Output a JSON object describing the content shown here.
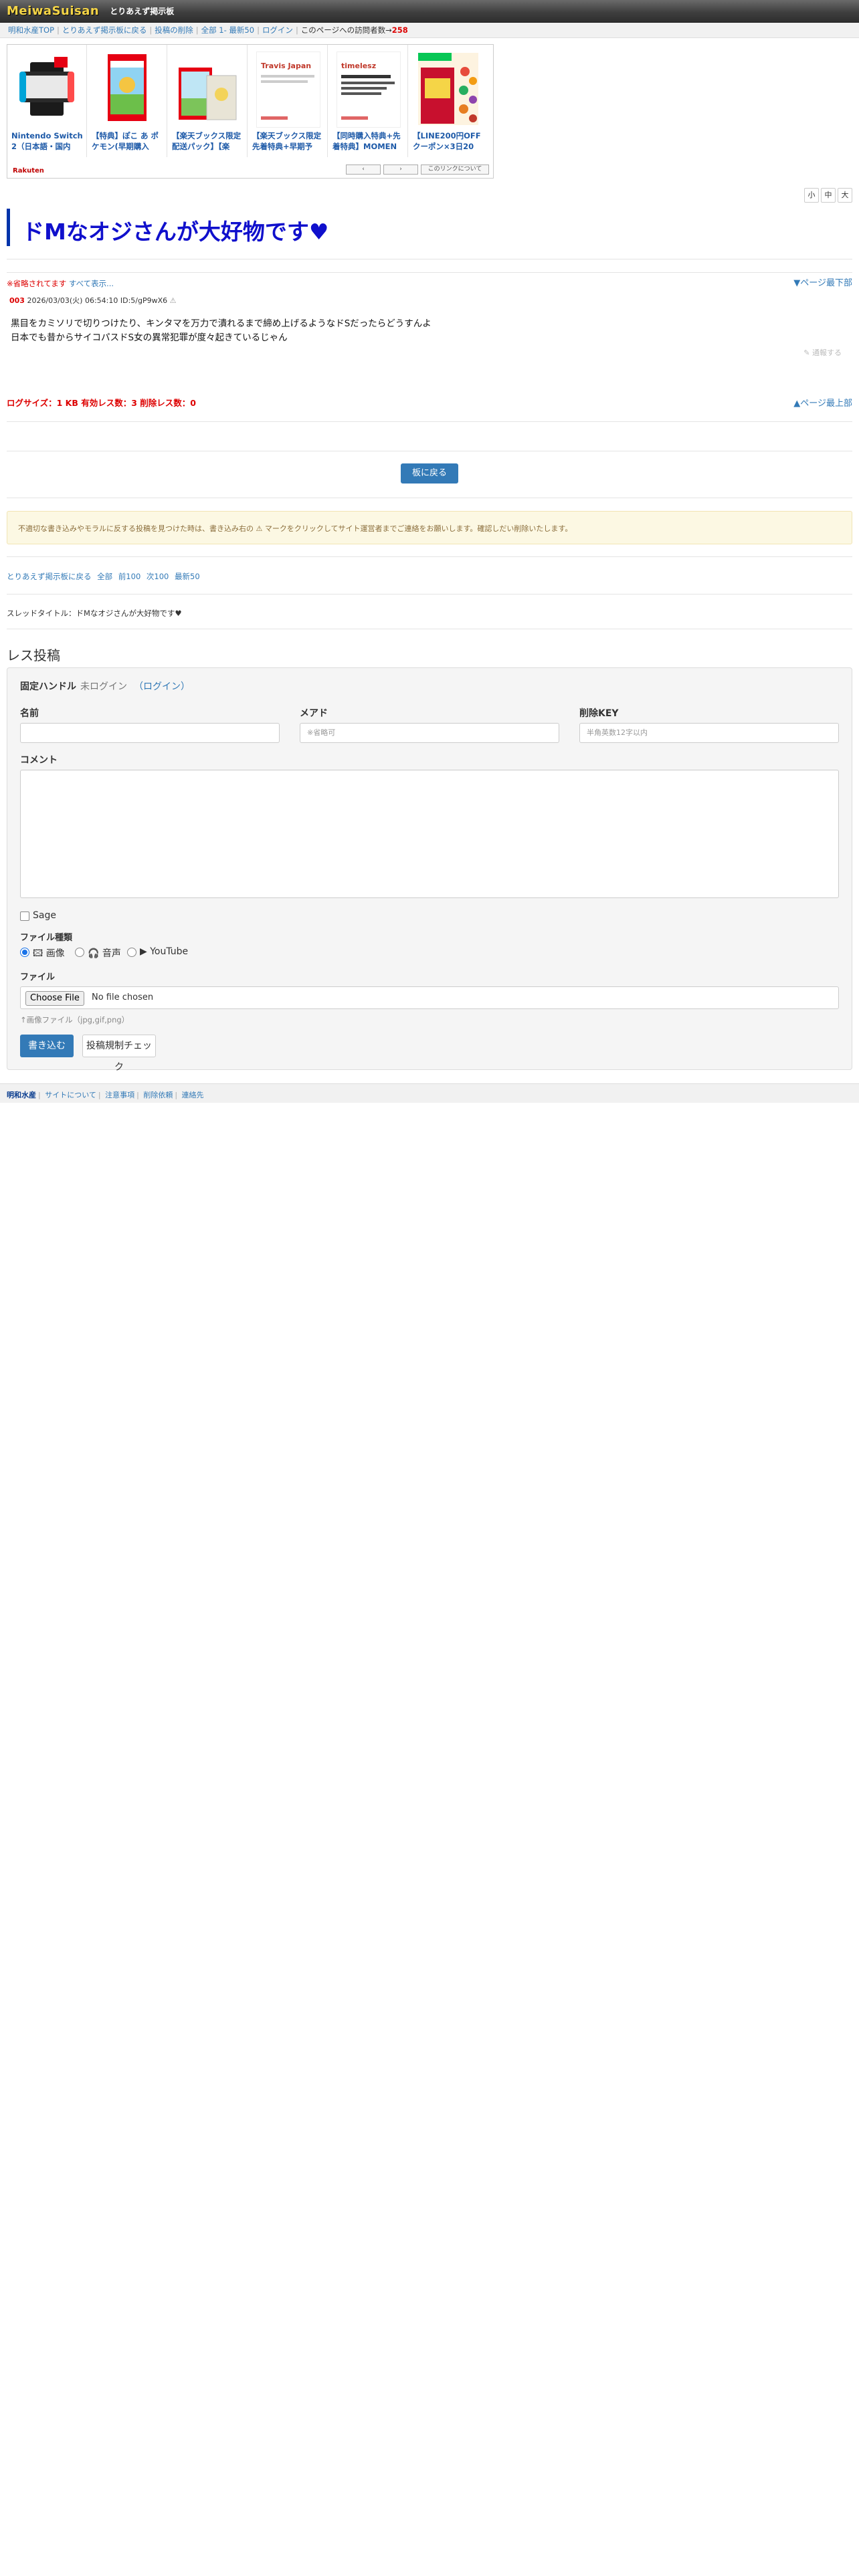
{
  "header": {
    "logo": "MeiwaSuisan",
    "board_name": "とりあえず掲示板"
  },
  "nav": {
    "links": [
      "明和水産TOP",
      "とりあえず掲示板に戻る",
      "投稿の削除",
      "全部",
      "1-",
      "最新50",
      "ログイン"
    ],
    "visitor_label": "このページへの訪問者数→",
    "visitor_count": "258"
  },
  "ads": {
    "items": [
      {
        "title": "Nintendo Switch 2（日本語・国内",
        "icon": "console-product-image"
      },
      {
        "title": "【特典】ぽこ あ ポケモン(早期購入",
        "icon": "game-box-image"
      },
      {
        "title": "【楽天ブックス限定配送パック】【楽",
        "icon": "game-box-image"
      },
      {
        "title": "【楽天ブックス限定先着特典+早期予",
        "icon": "album-cover-image",
        "cover_text": "Travis Japan"
      },
      {
        "title": "【同時購入特典+先着特典】MOMEN",
        "icon": "album-cover-image",
        "cover_text": "timelesz"
      },
      {
        "title": "【LINE200円OFFクーポン×3日20",
        "icon": "coupon-banner-image"
      }
    ],
    "footer_logo": "Rakuten",
    "buttons": [
      "‹",
      "›",
      "このリンクについて"
    ]
  },
  "font_size_buttons": [
    "小",
    "中",
    "大"
  ],
  "thread": {
    "title": "ドMなオジさんが大好物です♥",
    "omitted": "※省略されてます",
    "show_all": "すべて表示...",
    "page_down": "▼ページ最下部",
    "page_up": "▲ページ最上部",
    "log_size": "ログサイズ：1 KB 有効レス数：3 削除レス数：0",
    "back_button": "板に戻る"
  },
  "post": {
    "number": "003",
    "meta": "2026/03/03(火) 06:54:10 ID:5/gP9wX6",
    "body_lines": [
      "黒目をカミソリで切りつけたり、キンタマを万力で潰れるまで締め上げるようなドSだったらどうすんよ",
      "日本でも昔からサイコパスドS女の異常犯罪が度々起きているじゃん"
    ],
    "report": "通報する"
  },
  "notice": "不適切な書き込みやモラルに反する投稿を見つけた時は、書き込み右の ⚠ マークをクリックしてサイト運営者までご連絡をお願いします。確認しだい削除いたします。",
  "bottom_links": [
    "とりあえず掲示板に戻る",
    "全部",
    "前100",
    "次100",
    "最新50"
  ],
  "thread_title_line": "スレッドタイトル：ドMなオジさんが大好物です♥",
  "form": {
    "heading": "レス投稿",
    "handle_label": "固定ハンドル",
    "handle_status": "未ログイン",
    "login_link": "（ログイン）",
    "name_label": "名前",
    "mail_label": "メアド",
    "mail_placeholder": "※省略可",
    "delkey_label": "削除KEY",
    "delkey_placeholder": "半角英数12字以内",
    "comment_label": "コメント",
    "sage_label": "Sage",
    "filetype_label": "ファイル種類",
    "filetype_options": [
      "画像",
      "音声",
      "YouTube"
    ],
    "file_label": "ファイル",
    "choose_file": "Choose File",
    "no_file": "No file chosen",
    "file_hint": "↑画像ファイル（jpg,gif,png）",
    "submit": "書き込む",
    "check": "投稿規制チェック"
  },
  "footer": {
    "links": [
      "明和水産",
      "サイトについて",
      "注意事項",
      "削除依頼",
      "連絡先"
    ]
  },
  "colors": {
    "title": "#1010cc",
    "title_bar": "#0033aa",
    "primary_button": "#337ab7",
    "red_text": "#dd0000"
  }
}
